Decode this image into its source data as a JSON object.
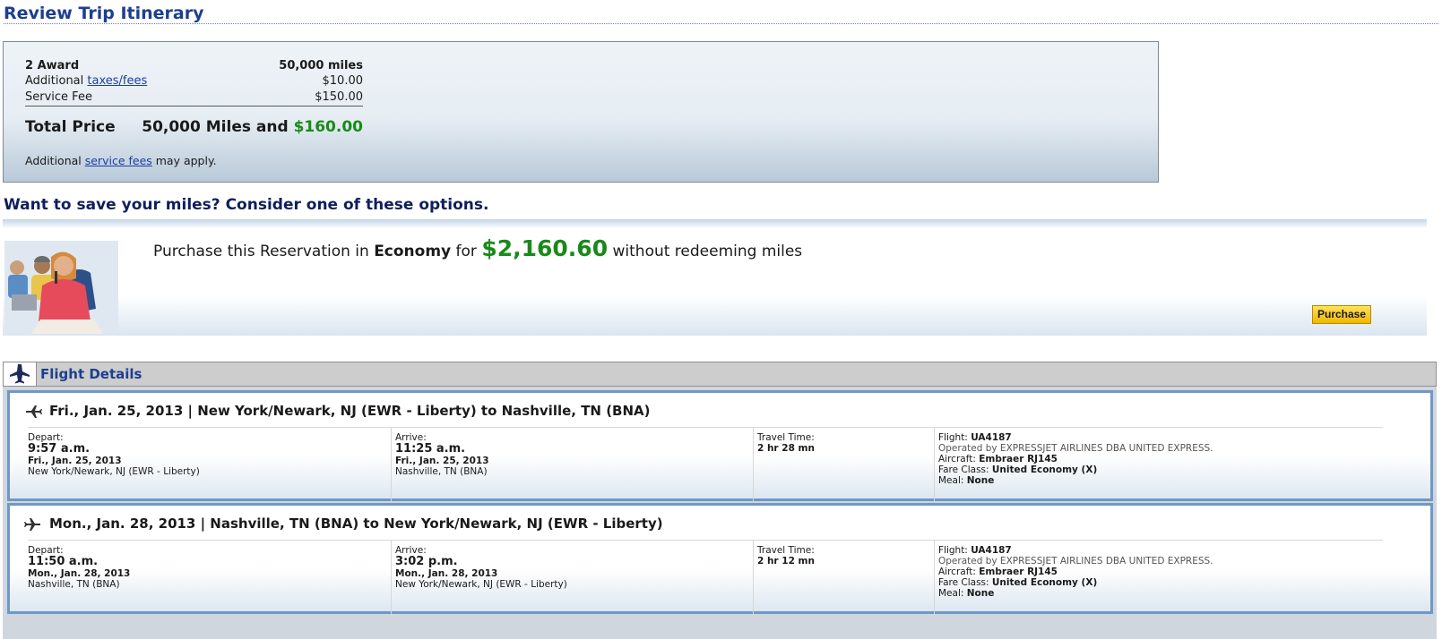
{
  "header": {
    "title": "Review Trip Itinerary"
  },
  "price": {
    "award_label": "2 Award",
    "award_value": "50,000 miles",
    "taxes_prefix": "Additional ",
    "taxes_link": "taxes/fees",
    "taxes_value": "$10.00",
    "service_label": "Service Fee",
    "service_value": "$150.00",
    "total_label": "Total Price",
    "total_miles": "50,000 Miles and ",
    "total_cash": "$160.00",
    "note_prefix": "Additional ",
    "note_link": "service fees",
    "note_suffix": " may apply."
  },
  "save": {
    "heading": "Want to save your miles? Consider one of these options."
  },
  "offer": {
    "prefix": "Purchase this Reservation in ",
    "cabin": "Economy",
    "for_word": " for ",
    "price": "$2,160.60",
    "suffix": " without redeeming miles",
    "button": "Purchase"
  },
  "flight_details": {
    "title": "Flight Details"
  },
  "segments": [
    {
      "heading": "Fri., Jan. 25, 2013 | New York/Newark, NJ (EWR - Liberty) to Nashville, TN (BNA)",
      "depart_label": "Depart:",
      "depart_time": "9:57 a.m.",
      "depart_date": "Fri., Jan. 25, 2013",
      "depart_city": "New York/Newark, NJ (EWR - Liberty)",
      "arrive_label": "Arrive:",
      "arrive_time": "11:25 a.m.",
      "arrive_date": "Fri., Jan. 25, 2013",
      "arrive_city": "Nashville, TN (BNA)",
      "travel_label": "Travel Time:",
      "travel_time": "2 hr 28 mn",
      "flight_label": "Flight: ",
      "flight_number": "UA4187",
      "operated_by": "Operated by EXPRESSJET AIRLINES DBA UNITED EXPRESS.",
      "aircraft_label": "Aircraft: ",
      "aircraft": "Embraer RJ145",
      "fare_label": "Fare Class: ",
      "fare_class": "United Economy (X)",
      "meal_label": "Meal: ",
      "meal": "None"
    },
    {
      "heading": "Mon., Jan. 28, 2013 | Nashville, TN (BNA) to New York/Newark, NJ (EWR - Liberty)",
      "depart_label": "Depart:",
      "depart_time": "11:50 a.m.",
      "depart_date": "Mon., Jan. 28, 2013",
      "depart_city": "Nashville, TN (BNA)",
      "arrive_label": "Arrive:",
      "arrive_time": "3:02 p.m.",
      "arrive_date": "Mon., Jan. 28, 2013",
      "arrive_city": "New York/Newark, NJ (EWR - Liberty)",
      "travel_label": "Travel Time:",
      "travel_time": "2 hr 12 mn",
      "flight_label": "Flight: ",
      "flight_number": "UA4187",
      "operated_by": "Operated by EXPRESSJET AIRLINES DBA UNITED EXPRESS.",
      "aircraft_label": "Aircraft: ",
      "aircraft": "Embraer RJ145",
      "fare_label": "Fare Class: ",
      "fare_class": "United Economy (X)",
      "meal_label": "Meal: ",
      "meal": "None"
    }
  ],
  "colors": {
    "title_blue": "#1c3f8f",
    "price_green": "#198a1a",
    "button_yellow": "#ffd21f",
    "segment_border": "#6f98c6"
  },
  "icons": [
    "airplane-icon",
    "departure-plane-icon",
    "return-plane-icon"
  ]
}
